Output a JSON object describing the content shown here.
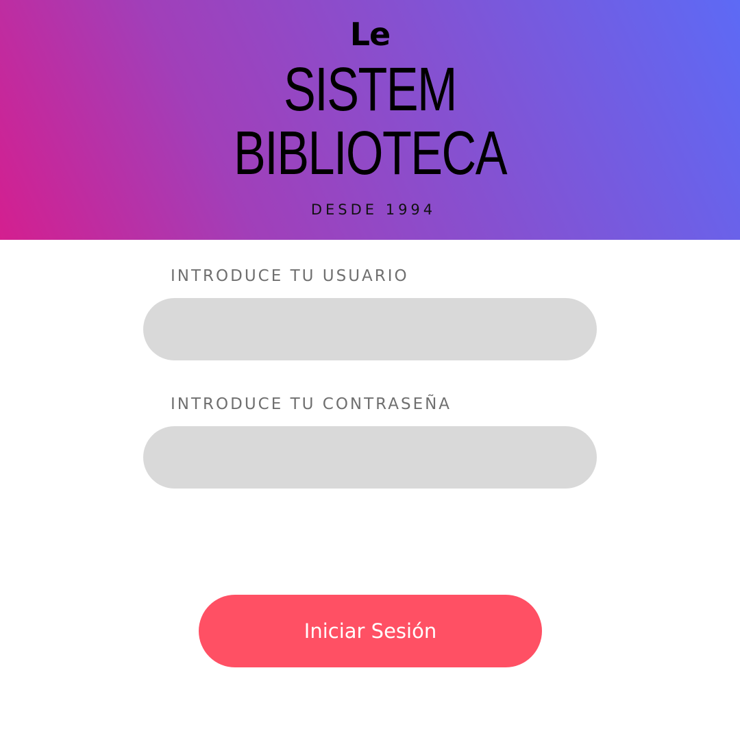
{
  "header": {
    "brand_small": "Le",
    "brand_line1": "SISTEM",
    "brand_line2": "BIBLIOTECA",
    "tagline": "DESDE 1994",
    "gradient_colors": [
      "#d41f8f",
      "#5d6af5"
    ]
  },
  "form": {
    "username_label": "INTRODUCE TU USUARIO",
    "username_value": "",
    "password_label": "INTRODUCE TU CONTRASEÑA",
    "password_value": "",
    "field_color": "#d9d9d9",
    "submit_label": "Iniciar Sesión",
    "submit_color": "#ff5064"
  }
}
